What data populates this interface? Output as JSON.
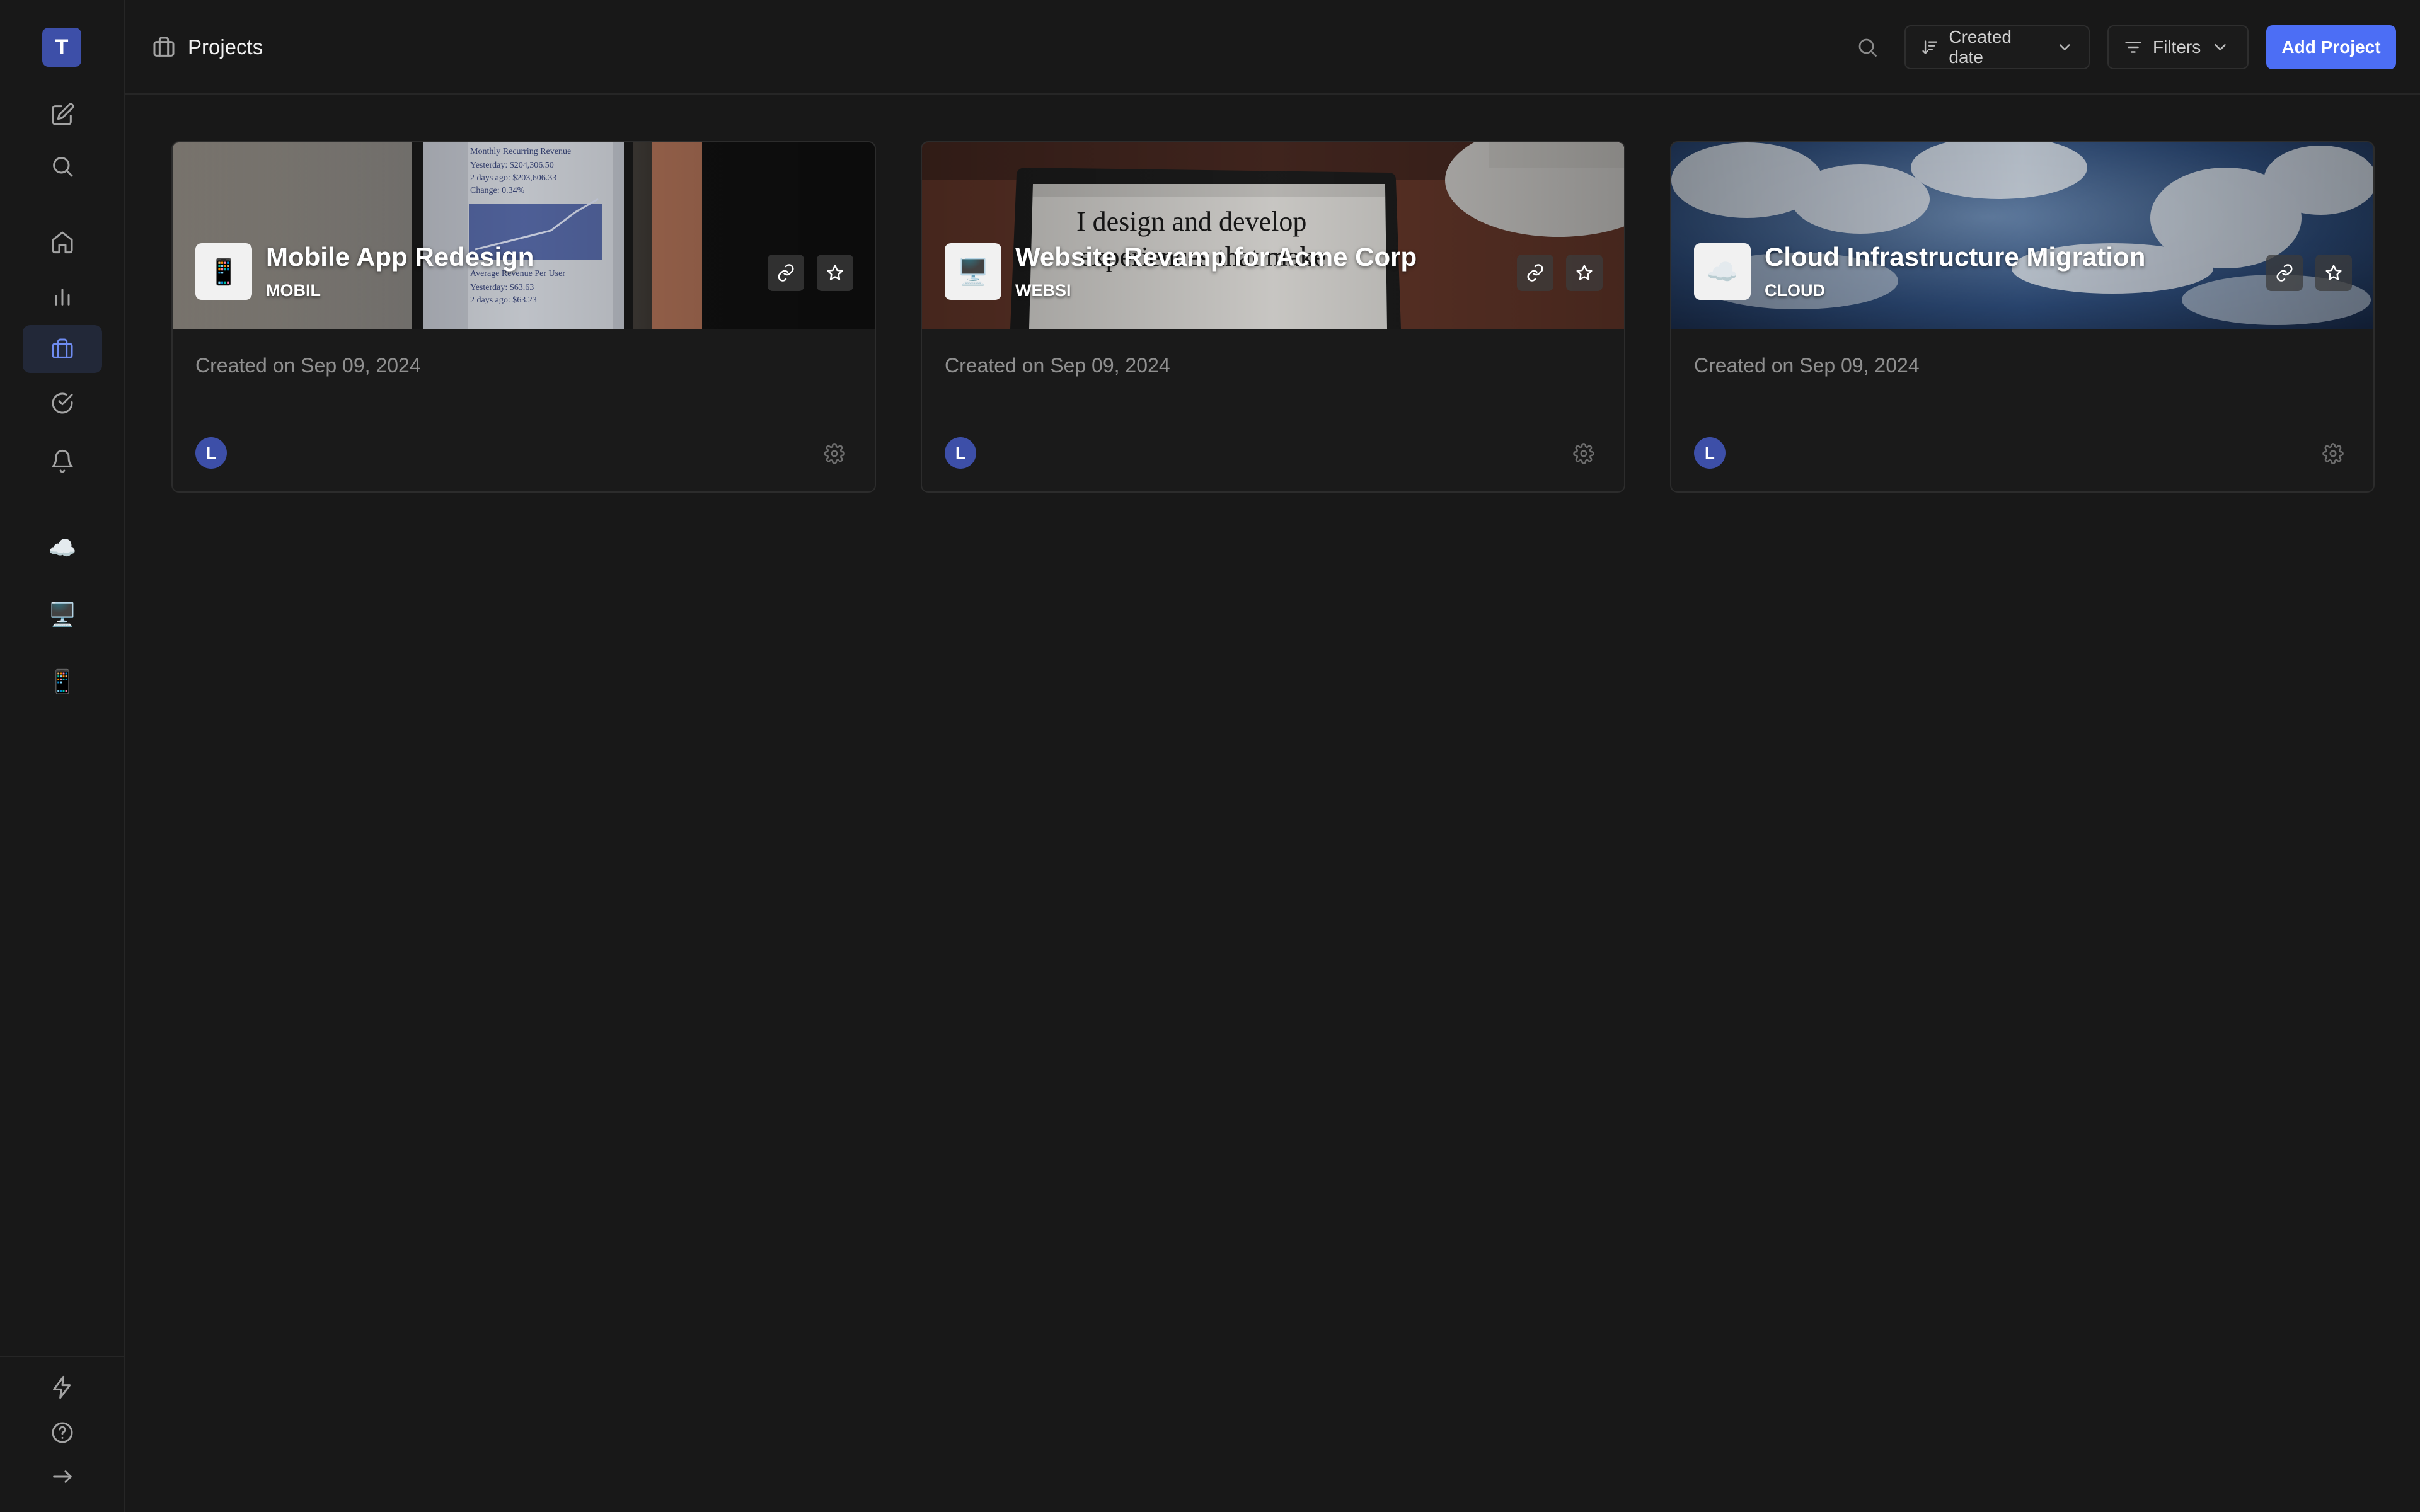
{
  "sidebar": {
    "workspace_initial": "T",
    "project_shortcuts": [
      {
        "icon": "☁️",
        "name": "cloud-icon"
      },
      {
        "icon": "🖥️",
        "name": "computer-icon"
      },
      {
        "icon": "📱",
        "name": "mobile-phone-icon"
      }
    ]
  },
  "header": {
    "title": "Projects",
    "sort_label": "Created date",
    "filters_label": "Filters",
    "add_label": "Add Project"
  },
  "projects": [
    {
      "name": "Mobile App Redesign",
      "code": "MOBIL",
      "logo": "📱",
      "created": "Created on Sep 09, 2024",
      "member_initial": "L"
    },
    {
      "name": "Website Revamp for Acme Corp",
      "code": "WEBSI",
      "logo": "🖥️",
      "created": "Created on Sep 09, 2024",
      "member_initial": "L"
    },
    {
      "name": "Cloud Infrastructure Migration",
      "code": "CLOUD",
      "logo": "☁️",
      "created": "Created on Sep 09, 2024",
      "member_initial": "L"
    }
  ],
  "colors": {
    "accent": "#4c6ef5",
    "background": "#181818",
    "avatar": "#3d4fa8"
  }
}
